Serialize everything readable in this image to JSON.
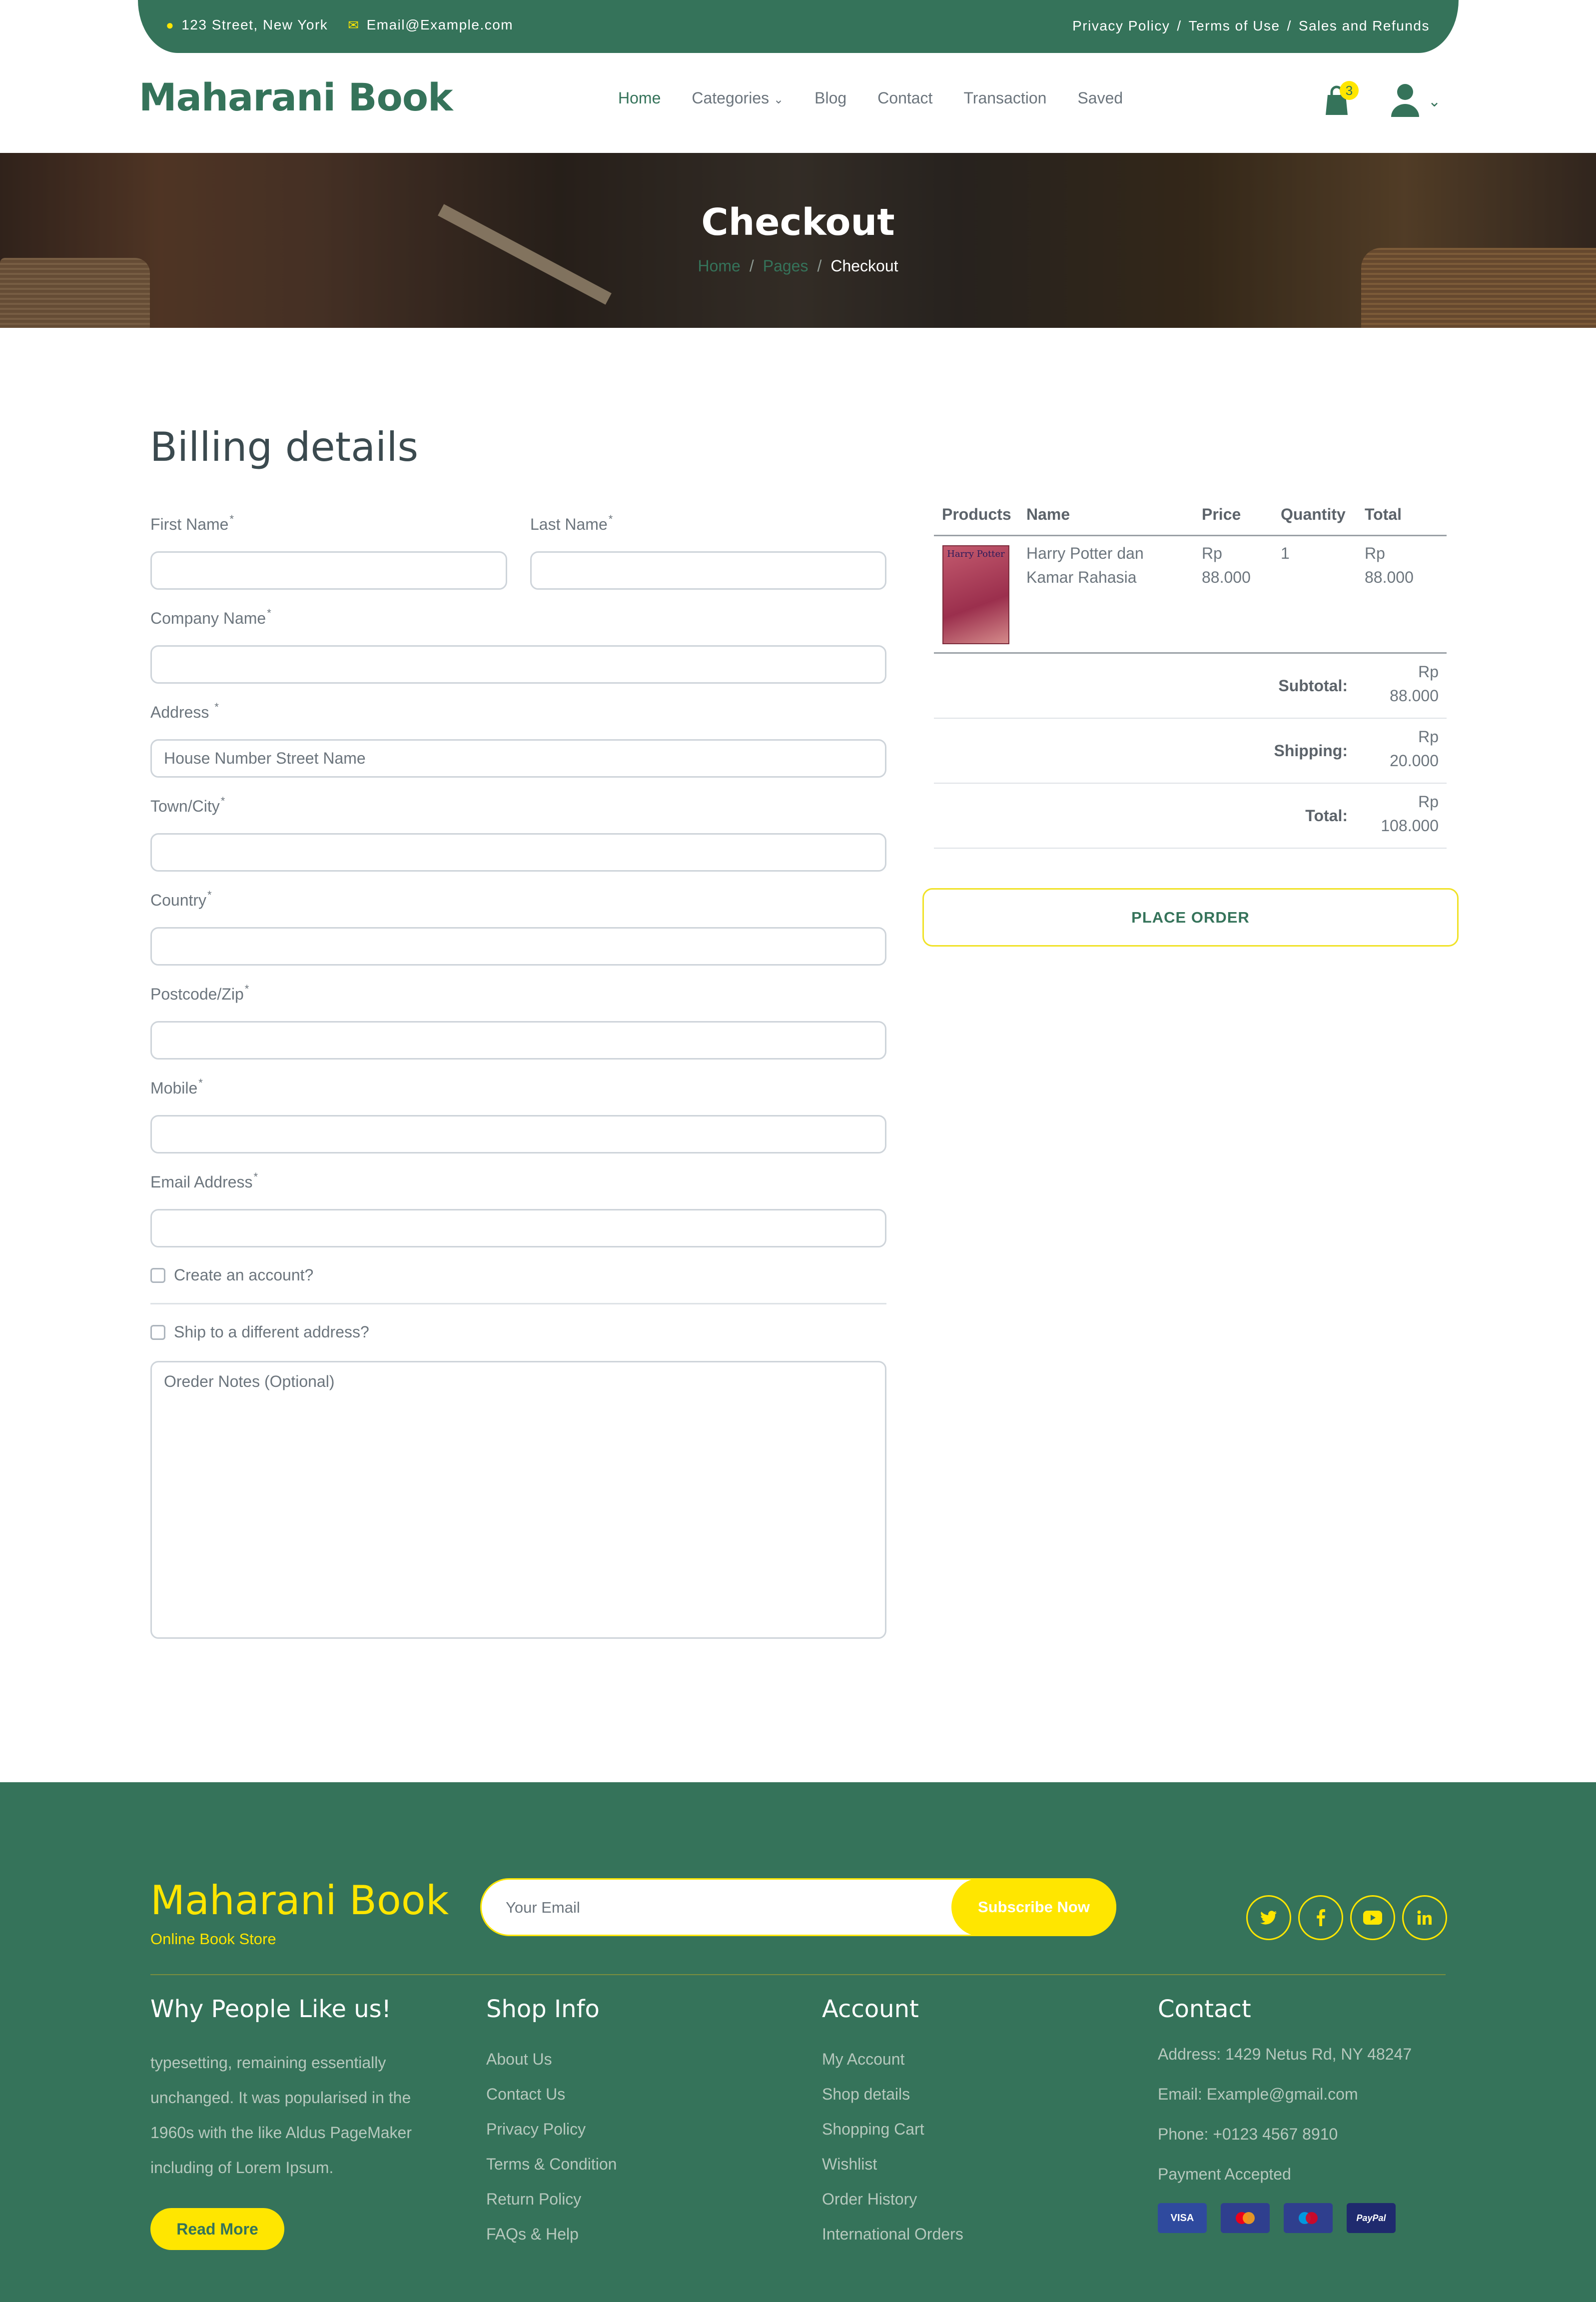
{
  "topbar": {
    "address": "123 Street, New York",
    "email": "Email@Example.com",
    "links": [
      "Privacy Policy",
      "Terms of Use",
      "Sales and Refunds"
    ],
    "separator": "/"
  },
  "header": {
    "brand": "Maharani Book",
    "nav": [
      "Home",
      "Categories",
      "Blog",
      "Contact",
      "Transaction",
      "Saved"
    ],
    "cart_count": "3"
  },
  "hero": {
    "title": "Checkout",
    "breadcrumb": [
      "Home",
      "Pages",
      "Checkout"
    ],
    "separator": "/"
  },
  "billing": {
    "heading": "Billing details",
    "fields": {
      "first_name": "First Name",
      "last_name": "Last Name",
      "company": "Company Name",
      "address": "Address",
      "address_placeholder": "House Number Street Name",
      "town": "Town/City",
      "country": "Country",
      "postcode": "Postcode/Zip",
      "mobile": "Mobile",
      "email": "Email Address",
      "required_mark": "*"
    },
    "create_account": "Create an account?",
    "ship_different": "Ship to a different address?",
    "notes_placeholder": "Oreder Notes (Optional)"
  },
  "order": {
    "columns": [
      "Products",
      "Name",
      "Price",
      "Quantity",
      "Total"
    ],
    "items": [
      {
        "name": "Harry Potter dan Kamar Rahasia",
        "price": "Rp 88.000",
        "quantity": "1",
        "total": "Rp 88.000",
        "cover_title": "Harry Potter"
      }
    ],
    "subtotal_label": "Subtotal:",
    "subtotal": "Rp 88.000",
    "shipping_label": "Shipping:",
    "shipping": "Rp 20.000",
    "total_label": "Total:",
    "total": "Rp 108.000",
    "place_order": "PLACE ORDER"
  },
  "footer": {
    "brand": "Maharani Book",
    "tagline": "Online Book Store",
    "email_placeholder": "Your Email",
    "subscribe": "Subscribe Now",
    "social": [
      "twitter-icon",
      "facebook-icon",
      "youtube-icon",
      "linkedin-icon"
    ],
    "why_title": "Why People Like us!",
    "why_text": "typesetting, remaining essentially unchanged. It was popularised in the 1960s with the like Aldus PageMaker including of Lorem Ipsum.",
    "read_more": "Read More",
    "shop_title": "Shop Info",
    "shop_links": [
      "About Us",
      "Contact Us",
      "Privacy Policy",
      "Terms & Condition",
      "Return Policy",
      "FAQs & Help"
    ],
    "account_title": "Account",
    "account_links": [
      "My Account",
      "Shop details",
      "Shopping Cart",
      "Wishlist",
      "Order History",
      "International Orders"
    ],
    "contact_title": "Contact",
    "contact_address": "Address: 1429 Netus Rd, NY 48247",
    "contact_email": "Email: Example@gmail.com",
    "contact_phone": "Phone: +0123 4567 8910",
    "payment_label": "Payment Accepted",
    "payments": [
      "VISA",
      "Mastercard",
      "Maestro",
      "PayPal"
    ]
  },
  "colors": {
    "primary": "#35735a",
    "accent": "#ffe600"
  }
}
